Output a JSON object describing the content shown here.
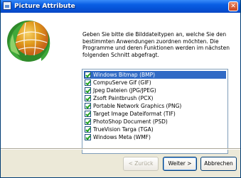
{
  "window": {
    "title": "Picture Attribute",
    "close_glyph": "✕"
  },
  "intro_text": "Geben Sie bitte die Bilddateitypen an, welche Sie den bestimmten Anwendungen zuordnen möchten. Die Programme und deren Funktionen werden im nächsten folgenden Schnitt abgefragt.",
  "file_types": [
    {
      "label": "Windows Bitmap (BMP)",
      "checked": true,
      "selected": true
    },
    {
      "label": "CompuServe Gif (GIF)",
      "checked": true,
      "selected": false
    },
    {
      "label": "Jpeg Dateien (JPG/JPEG)",
      "checked": true,
      "selected": false
    },
    {
      "label": "Zsoft Paintbrush (PCX)",
      "checked": true,
      "selected": false
    },
    {
      "label": "Portable Network Graphics (PNG)",
      "checked": true,
      "selected": false
    },
    {
      "label": "Target Image Dateiformat (TIF)",
      "checked": true,
      "selected": false
    },
    {
      "label": "PhotoShop Document (PSD)",
      "checked": true,
      "selected": false
    },
    {
      "label": "TrueVision Targa (TGA)",
      "checked": true,
      "selected": false
    },
    {
      "label": "Windows Meta (WMF)",
      "checked": true,
      "selected": false
    }
  ],
  "buttons": {
    "back": "< Zurück",
    "next": "Weiter >",
    "cancel": "Abbrechen"
  },
  "icons": {
    "app": "picture-icon",
    "logo": "globe-logo-icon",
    "check": "checkmark-icon"
  },
  "colors": {
    "titlebar": "#0a5fe4",
    "selection": "#316ac5",
    "checkmark": "#21a121",
    "dialog_bg": "#ece9d8"
  }
}
